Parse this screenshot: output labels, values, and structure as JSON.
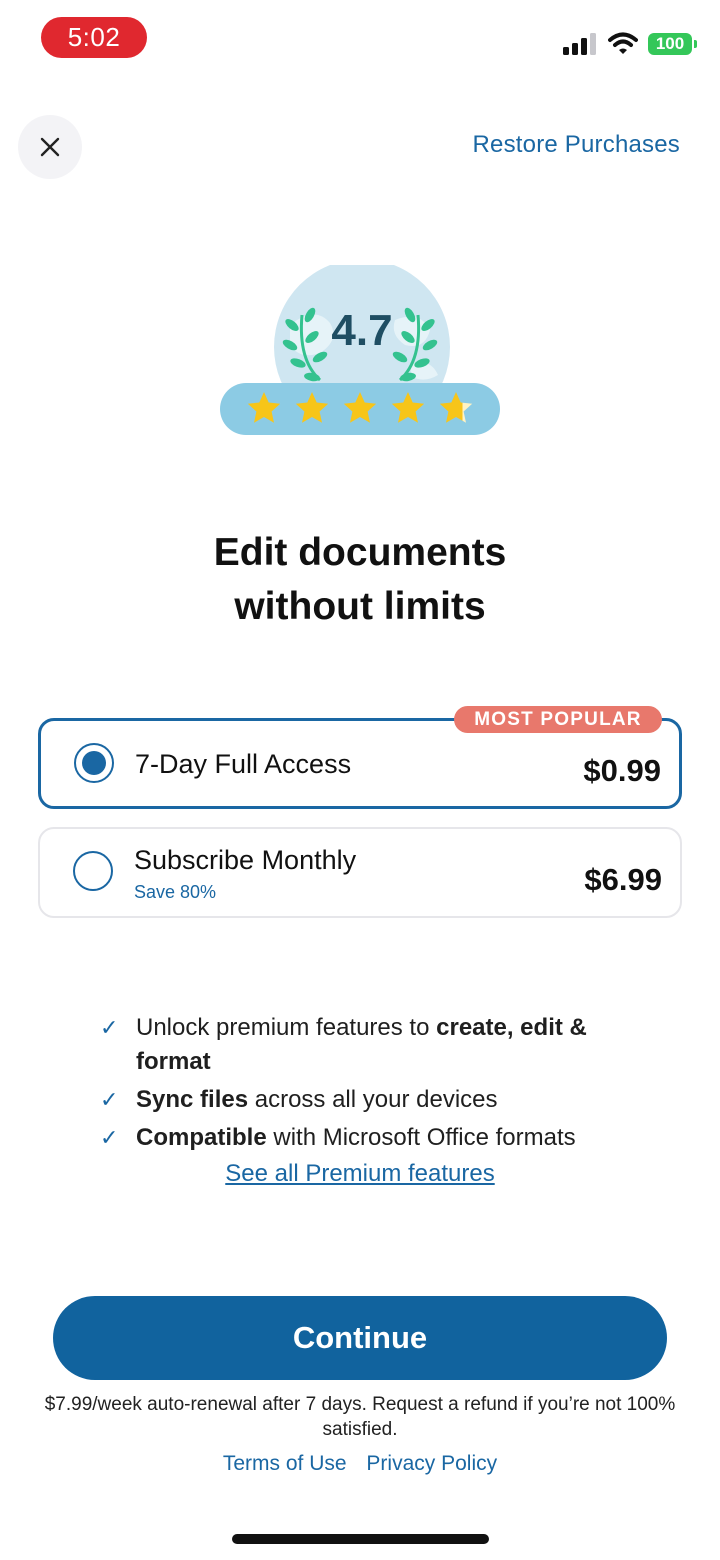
{
  "status_bar": {
    "time": "5:02",
    "battery": "100"
  },
  "top_bar": {
    "restore_label": "Restore Purchases"
  },
  "rating": {
    "value": "4.7",
    "stars": 4.7
  },
  "headline": {
    "line1": "Edit documents",
    "line2": "without limits"
  },
  "plans": [
    {
      "title": "7-Day Full Access",
      "price": "$0.99",
      "badge": "MOST POPULAR",
      "selected": true
    },
    {
      "title": "Subscribe Monthly",
      "subtitle": "Save 80%",
      "price": "$6.99",
      "selected": false
    }
  ],
  "features": [
    {
      "pre": "Unlock premium features to ",
      "bold": "create, edit & format",
      "post": ""
    },
    {
      "pre": "",
      "bold": "Sync files",
      "post": " across all your devices"
    },
    {
      "pre": "",
      "bold": "Compatible",
      "post": " with Microsoft Office formats"
    }
  ],
  "see_all_label": "See all Premium features",
  "cta": {
    "label": "Continue"
  },
  "disclaimer": "$7.99/week auto-renewal after 7 days. Request a refund if you’re not 100% satisfied.",
  "links": {
    "terms": "Terms of Use",
    "privacy": "Privacy Policy"
  },
  "colors": {
    "brand": "#11639e",
    "badge": "#e8786c",
    "star": "#f7c519",
    "leaf": "#34c28f"
  },
  "icons": {
    "close": "close-icon",
    "check": "check-icon",
    "wifi": "wifi-icon",
    "signal": "signal-icon",
    "battery": "battery-icon"
  }
}
